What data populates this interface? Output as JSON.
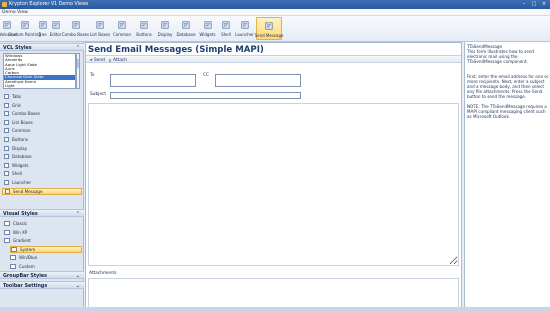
{
  "window": {
    "title": "Krypton Explorer V1 Demo Views"
  },
  "menu": [
    "Demo",
    "View"
  ],
  "ribbon": [
    {
      "label": "Welcome",
      "icon": "welcome-icon"
    },
    {
      "label": "Custom Painting",
      "icon": "paint-icon"
    },
    {
      "label": "Tree",
      "icon": "tree-icon"
    },
    {
      "label": "Editor",
      "icon": "editor-icon"
    },
    {
      "label": "Combo Boxes",
      "icon": "combo-icon"
    },
    {
      "label": "List Boxes",
      "icon": "list-icon"
    },
    {
      "label": "Common",
      "icon": "common-icon"
    },
    {
      "label": "Buttons",
      "icon": "button-icon"
    },
    {
      "label": "Display",
      "icon": "display-icon"
    },
    {
      "label": "Database",
      "icon": "database-icon"
    },
    {
      "label": "Widgets",
      "icon": "widget-icon"
    },
    {
      "label": "Shell",
      "icon": "shell-icon"
    },
    {
      "label": "Launcher",
      "icon": "launcher-icon"
    },
    {
      "label": "Send Message",
      "icon": "mail-icon"
    }
  ],
  "sidebar": {
    "vcl_styles": {
      "header": "VCL Styles",
      "chevron": "⌃",
      "options": [
        "Windows",
        "Amakrits",
        "Aqua Light Slate",
        "Auric",
        "Carbon",
        "Charcoal Dark Slate",
        "Amethyst Kamri",
        "Light",
        "Aqua Graphite",
        "Carbon"
      ],
      "selected_index": 5
    },
    "nav_items": [
      {
        "label": "Tabs",
        "icon": "tabs-icon"
      },
      {
        "label": "Grid",
        "icon": "grid-icon"
      },
      {
        "label": "Combo Boxes",
        "icon": "combo-boxes-icon"
      },
      {
        "label": "List Boxes",
        "icon": "list-boxes-icon"
      },
      {
        "label": "Common",
        "icon": "common-icon"
      },
      {
        "label": "Buttons",
        "icon": "buttons-icon"
      },
      {
        "label": "Display",
        "icon": "display-icon"
      },
      {
        "label": "Database",
        "icon": "database-icon"
      },
      {
        "label": "Widgets",
        "icon": "widgets-icon"
      },
      {
        "label": "Shell",
        "icon": "shell-icon"
      },
      {
        "label": "Launcher",
        "icon": "launcher-icon"
      },
      {
        "label": "Send Message",
        "icon": "send-message-icon"
      }
    ],
    "visual_styles": {
      "header": "Visual Styles",
      "chevron": "⌃",
      "items": [
        {
          "label": "Classic",
          "indent": false
        },
        {
          "label": "Win XP",
          "indent": false
        },
        {
          "label": "Gradient",
          "indent": false
        },
        {
          "label": "System",
          "indent": true
        },
        {
          "label": "Win/Blue",
          "indent": true
        },
        {
          "label": "Custom",
          "indent": true
        }
      ],
      "selected_index": 3
    },
    "groupbar_styles": {
      "header": "GroupBar Styles",
      "chevron": "⌄"
    },
    "toolbar_settings": {
      "header": "Toolbar Settings",
      "chevron": "⌄"
    }
  },
  "main": {
    "title": "Send Email Messages (Simple MAPI)",
    "toolbar": [
      {
        "label": "Send",
        "icon": "send-icon"
      },
      {
        "label": "Attach",
        "icon": "attach-icon"
      }
    ],
    "fields": {
      "to_label": "To",
      "cc_label": "CC",
      "subject_label": "Subject",
      "to_value": "",
      "cc_value": "",
      "subject_value": "",
      "body_value": "",
      "attachments_label": "Attachments"
    }
  },
  "description": {
    "paragraphs": [
      "TTaSendMessage\nThis form illustrates how to send electronic mail using the TTaSendMessage component.",
      "First, enter the email address for one or more recipients. Next, enter a subject and a message body, and then select any file attachments. Press the Send button to send the message.",
      "NOTE: The TTaSendMessage requires a MAPI compliant messaging client such as Microsoft Outlook."
    ]
  }
}
